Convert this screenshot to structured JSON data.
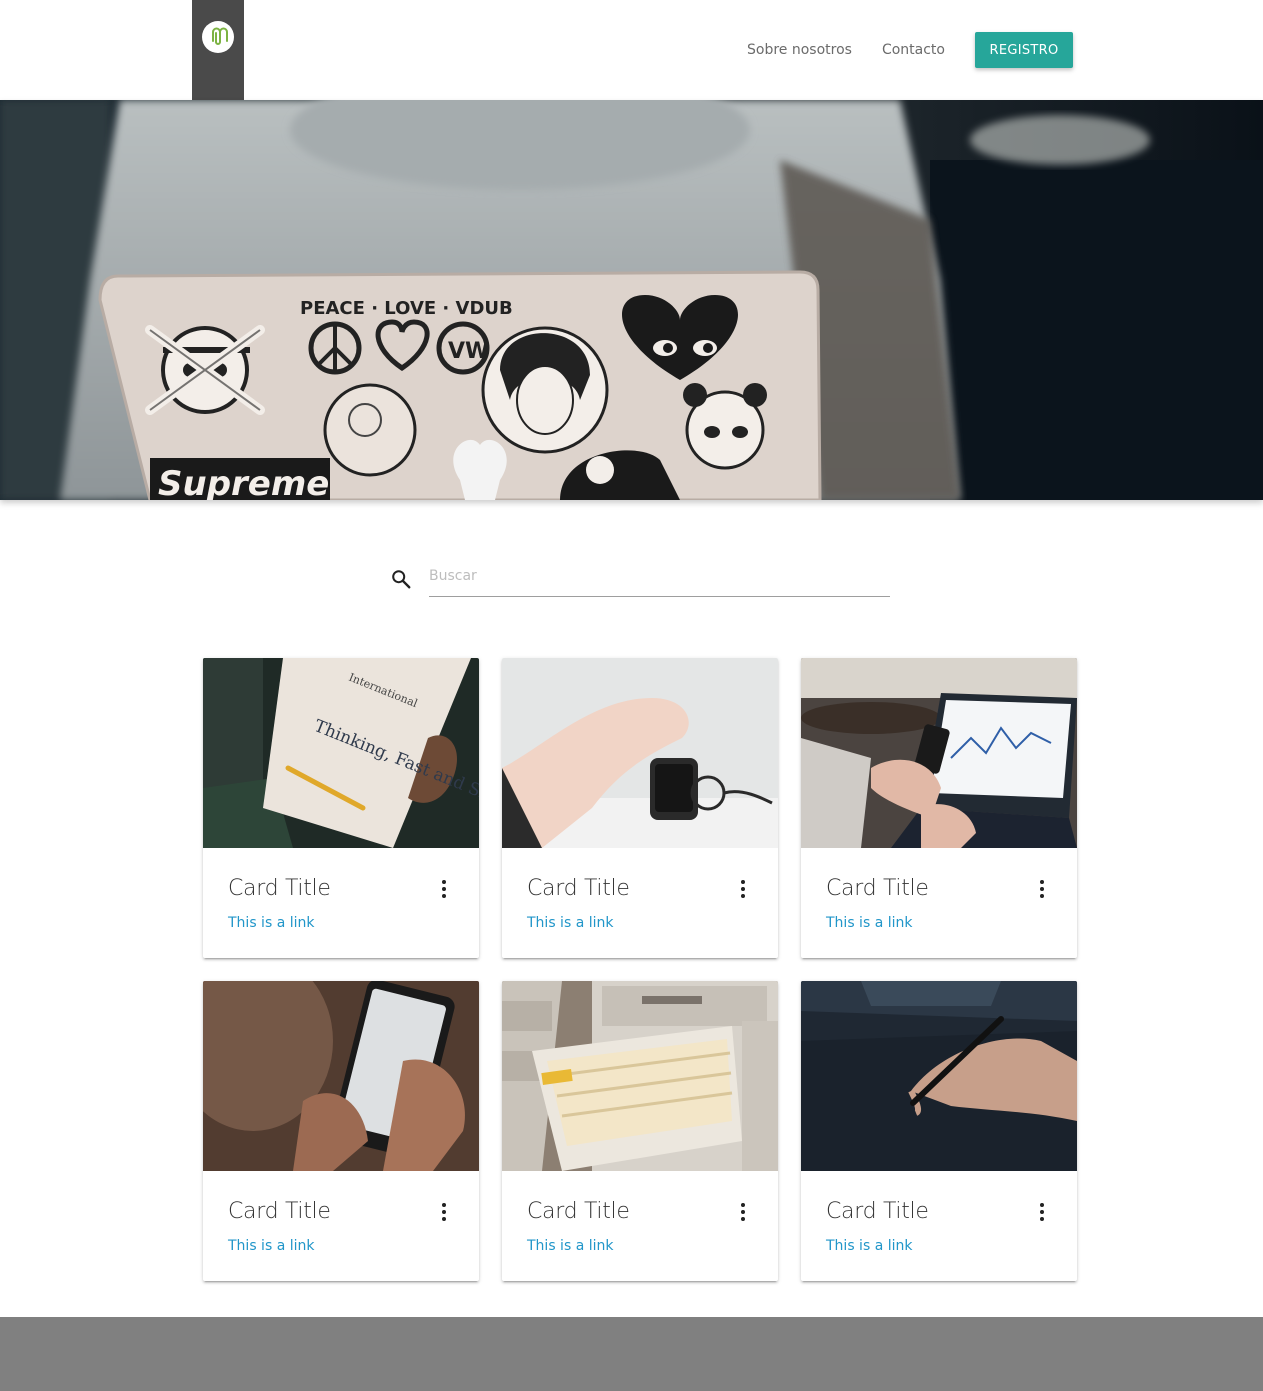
{
  "header": {
    "nav": [
      {
        "label": "Sobre nosotros"
      },
      {
        "label": "Contacto"
      }
    ],
    "register_label": "REGISTRO",
    "accent_color": "#26a69a",
    "logo_bg_color": "#4a4a4a",
    "logo_icon": "paperclip-icon"
  },
  "hero": {
    "image": "person-using-laptop-with-stickers",
    "sticker_texts": [
      "PEACE · LOVE · VDUB",
      "Supreme"
    ]
  },
  "search": {
    "placeholder": "Buscar",
    "value": "",
    "icon": "search-icon"
  },
  "cards": [
    {
      "title": "Card Title",
      "link": "This is a link",
      "image": "book-thinking-fast-and-slow",
      "book_text": "Thinking, Fast and Slow"
    },
    {
      "title": "Card Title",
      "link": "This is a link",
      "image": "hand-with-smartwatch"
    },
    {
      "title": "Card Title",
      "link": "This is a link",
      "image": "phone-and-laptop-charts"
    },
    {
      "title": "Card Title",
      "link": "This is a link",
      "image": "hands-on-smartphone"
    },
    {
      "title": "Card Title",
      "link": "This is a link",
      "image": "file-cabinet-drawer"
    },
    {
      "title": "Card Title",
      "link": "This is a link",
      "image": "hand-with-stylus-tablet"
    }
  ],
  "colors": {
    "link": "#2196c9",
    "footer": "#808080"
  }
}
